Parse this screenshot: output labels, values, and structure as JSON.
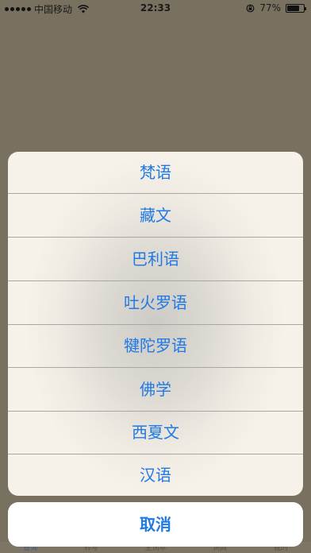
{
  "status_bar": {
    "carrier": "中国移动",
    "time": "22:33",
    "battery": "77%",
    "battery_level": 0.77,
    "icons": [
      "signal-icon",
      "wifi-icon",
      "lock-rotation-icon",
      "battery-icon"
    ]
  },
  "action_sheet": {
    "options": [
      {
        "label": "梵语"
      },
      {
        "label": "藏文"
      },
      {
        "label": "巴利语"
      },
      {
        "label": "吐火罗语"
      },
      {
        "label": "犍陀罗语"
      },
      {
        "label": "佛学"
      },
      {
        "label": "西夏文"
      },
      {
        "label": "汉语"
      }
    ],
    "cancel_label": "取消",
    "accent_color": "#1f79e6"
  },
  "tab_bar": {
    "tabs": [
      {
        "label": "查询"
      },
      {
        "label": "转写"
      },
      {
        "label": "生词本"
      },
      {
        "label": "词典"
      },
      {
        "label": "我的"
      }
    ]
  }
}
